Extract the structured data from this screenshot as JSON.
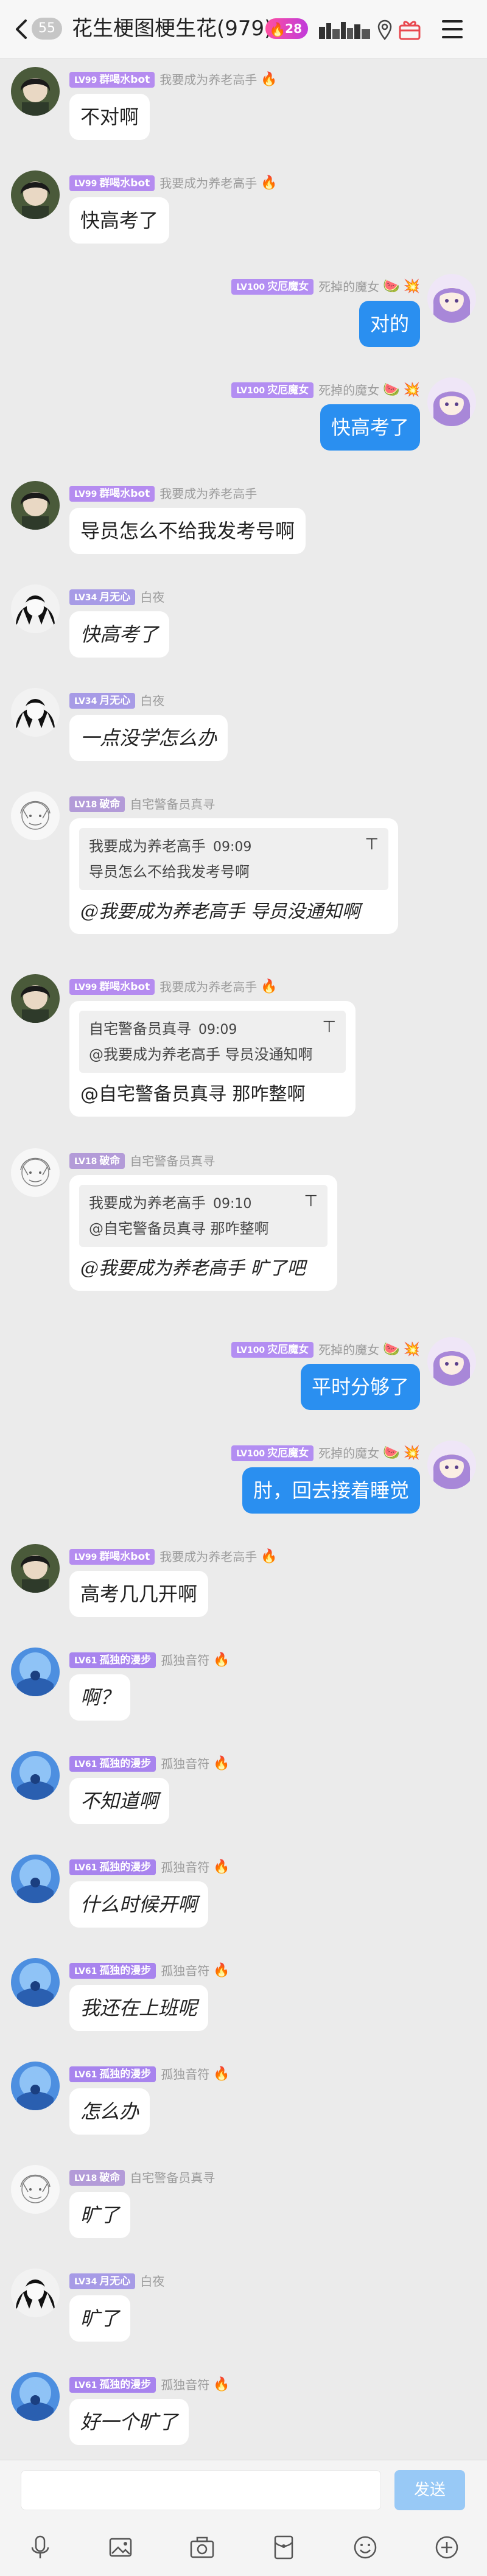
{
  "header": {
    "back_count": "55",
    "title": "花生梗图梗生花(979)",
    "hot_count": "28"
  },
  "messages": [
    {
      "side": "left",
      "avatar": "avatar-dark-hair",
      "level": "LV99",
      "title": "群喝水bot",
      "nick": "我要成为养老高手",
      "flame": true,
      "text": "不对啊"
    },
    {
      "side": "left",
      "avatar": "avatar-dark-hair",
      "level": "LV99",
      "title": "群喝水bot",
      "nick": "我要成为养老高手",
      "flame": true,
      "text": "快高考了"
    },
    {
      "side": "right",
      "avatar": "avatar-purple-hair",
      "level": "LV100",
      "title": "灾厄魔女",
      "nick": "死掉的魔女",
      "text": "对的"
    },
    {
      "side": "right",
      "avatar": "avatar-purple-hair",
      "level": "LV100",
      "title": "灾厄魔女",
      "nick": "死掉的魔女",
      "text": "快高考了"
    },
    {
      "side": "left",
      "avatar": "avatar-dark-hair",
      "level": "LV99",
      "title": "群喝水bot",
      "nick": "我要成为养老高手",
      "text": "导员怎么不给我发考号啊"
    },
    {
      "side": "left",
      "avatar": "avatar-mono",
      "level": "LV34",
      "title": "月无心",
      "nick": "白夜",
      "text": "快高考了",
      "hand": true
    },
    {
      "side": "left",
      "avatar": "avatar-mono",
      "level": "LV34",
      "title": "月无心",
      "nick": "白夜",
      "text": "一点没学怎么办",
      "hand": true
    },
    {
      "side": "left",
      "avatar": "avatar-sketch",
      "level": "LV18",
      "title": "破命",
      "nick": "自宅警备员真寻",
      "reply": {
        "name": "我要成为养老高手",
        "time": "09:09",
        "body": "导员怎么不给我发考号啊"
      },
      "text": "@我要成为养老高手 导员没通知啊",
      "hand": true
    },
    {
      "side": "left",
      "avatar": "avatar-dark-hair",
      "level": "LV99",
      "title": "群喝水bot",
      "nick": "我要成为养老高手",
      "flame": true,
      "reply": {
        "name": "自宅警备员真寻",
        "time": "09:09",
        "body": "@我要成为养老高手  导员没通知啊"
      },
      "text": "@自宅警备员真寻  那咋整啊"
    },
    {
      "side": "left",
      "avatar": "avatar-sketch",
      "level": "LV18",
      "title": "破命",
      "nick": "自宅警备员真寻",
      "reply": {
        "name": "我要成为养老高手",
        "time": "09:10",
        "body": "@自宅警备员真寻  那咋整啊"
      },
      "text": "@我要成为养老高手 旷了吧",
      "hand": true
    },
    {
      "side": "right",
      "avatar": "avatar-purple-hair",
      "level": "LV100",
      "title": "灾厄魔女",
      "nick": "死掉的魔女",
      "text": "平时分够了"
    },
    {
      "side": "right",
      "avatar": "avatar-purple-hair",
      "level": "LV100",
      "title": "灾厄魔女",
      "nick": "死掉的魔女",
      "text": "肘，回去接着睡觉"
    },
    {
      "side": "left",
      "avatar": "avatar-dark-hair",
      "level": "LV99",
      "title": "群喝水bot",
      "nick": "我要成为养老高手",
      "flame": true,
      "text": "高考几几开啊"
    },
    {
      "side": "left",
      "avatar": "avatar-blue-sky",
      "level": "LV61",
      "title": "孤独的漫步",
      "nick": "孤独音符",
      "flame": true,
      "text": "啊？",
      "hand": true
    },
    {
      "side": "left",
      "avatar": "avatar-blue-sky",
      "level": "LV61",
      "title": "孤独的漫步",
      "nick": "孤独音符",
      "flame": true,
      "text": "不知道啊",
      "hand": true
    },
    {
      "side": "left",
      "avatar": "avatar-blue-sky",
      "level": "LV61",
      "title": "孤独的漫步",
      "nick": "孤独音符",
      "flame": true,
      "text": "什么时候开啊",
      "hand": true
    },
    {
      "side": "left",
      "avatar": "avatar-blue-sky",
      "level": "LV61",
      "title": "孤独的漫步",
      "nick": "孤独音符",
      "flame": true,
      "text": "我还在上班呢",
      "hand": true
    },
    {
      "side": "left",
      "avatar": "avatar-blue-sky",
      "level": "LV61",
      "title": "孤独的漫步",
      "nick": "孤独音符",
      "flame": true,
      "text": "怎么办",
      "hand": true
    },
    {
      "side": "left",
      "avatar": "avatar-sketch",
      "level": "LV18",
      "title": "破命",
      "nick": "自宅警备员真寻",
      "text": "旷了",
      "hand": true
    },
    {
      "side": "left",
      "avatar": "avatar-mono",
      "level": "LV34",
      "title": "月无心",
      "nick": "白夜",
      "text": "旷了",
      "hand": true
    },
    {
      "side": "left",
      "avatar": "avatar-blue-sky",
      "level": "LV61",
      "title": "孤独的漫步",
      "nick": "孤独音符",
      "flame": true,
      "text": "好一个旷了",
      "hand": true
    }
  ],
  "input": {
    "placeholder": "",
    "send_label": "发送"
  },
  "toolbar": [
    "mic-icon",
    "image-icon",
    "camera-icon",
    "red-packet-icon",
    "emoji-icon",
    "plus-icon"
  ],
  "colors": {
    "lv99": "#b58cf0",
    "lv34": "#a79be6",
    "lv18": "#b39bd8",
    "lv100": "#b38ef2",
    "lv61": "#a884ee",
    "my_bubble": "#2a8ff0",
    "send_disabled": "#98c9f6"
  }
}
